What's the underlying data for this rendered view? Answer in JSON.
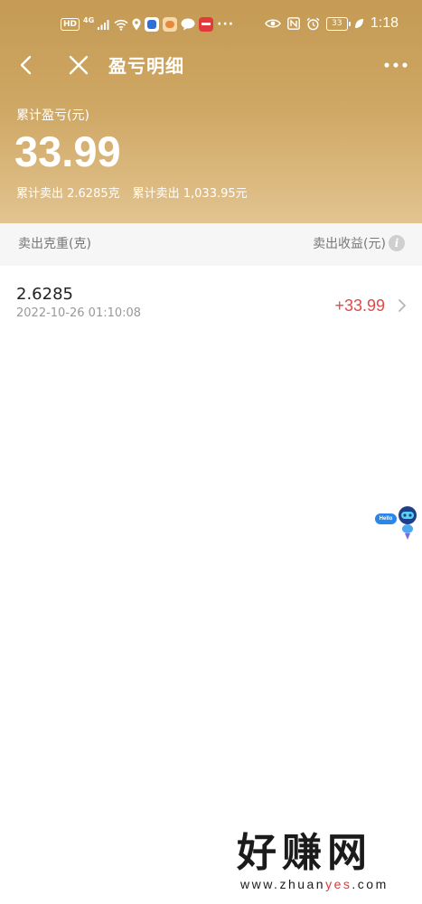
{
  "status_bar": {
    "hd_badge": "HD",
    "network": "4G",
    "signal_icon": "signal-bars-icon",
    "wifi_icon": "wifi-icon",
    "location_icon": "location-pin-icon",
    "app_icons": [
      "app-blue-icon",
      "app-orange-icon",
      "chat-bubble-icon",
      "app-red-icon"
    ],
    "more_dots": "···",
    "eye_icon": "eye-icon",
    "nfc_icon": "nfc-icon",
    "alarm_icon": "alarm-clock-icon",
    "battery": "33",
    "leaf_icon": "leaf-icon",
    "time": "1:18"
  },
  "nav": {
    "back_icon": "back-arrow-icon",
    "close_icon": "close-icon",
    "title": "盈亏明细",
    "more_icon": "more-dots-icon"
  },
  "summary": {
    "label": "累计盈亏(元)",
    "value": "33.99",
    "sold_weight": "累计卖出 2.6285克",
    "sold_amount": "累计卖出 1,033.95元"
  },
  "columns": {
    "left": "卖出克重(克)",
    "right": "卖出收益(元)",
    "info_icon": "info-icon",
    "info_glyph": "i"
  },
  "records": [
    {
      "weight": "2.6285",
      "time": "2022-10-26 01:10:08",
      "profit": "+33.99",
      "chevron_icon": "chevron-right-icon"
    }
  ],
  "assistant": {
    "bubble": "Hello",
    "icon": "robot-assistant-icon"
  },
  "watermark": {
    "text": "好赚网",
    "url_prefix": "www.zhuan",
    "url_highlight": "yes",
    "url_suffix": ".com"
  },
  "colors": {
    "header_gold": "#c49a54",
    "header_gold_light": "#e2c490",
    "profit_red": "#e0484b",
    "column_bg": "#f6f6f6"
  }
}
